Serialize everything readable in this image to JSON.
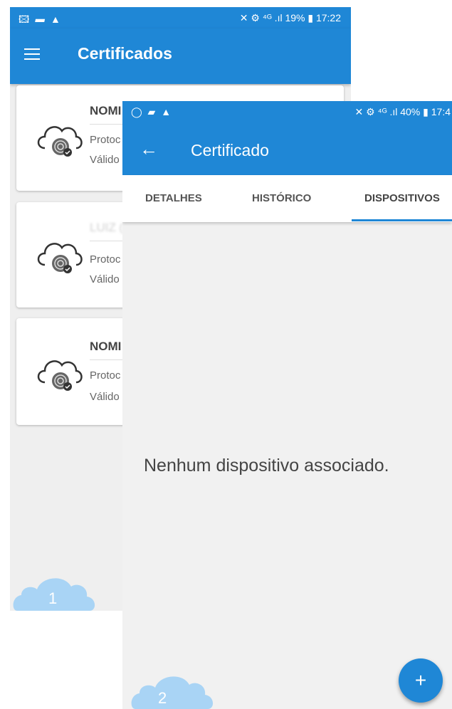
{
  "screen1": {
    "status": {
      "left_icons": "🖾 ▰ ▲",
      "right": "✕ ⚙ ⁴ᴳ .ıl 19% ▮ 17:22"
    },
    "title": "Certificados",
    "cards": [
      {
        "name": "NOMI",
        "protocol": "Protoc",
        "valid": "Válido"
      },
      {
        "name": "LUIZ (",
        "protocol": "Protoc",
        "valid": "Válido"
      },
      {
        "name": "NOMI",
        "protocol": "Protoc",
        "valid": "Válido"
      }
    ],
    "badge": "1"
  },
  "screen2": {
    "status": {
      "left_icons": "◯ ▰ ▲",
      "right": "✕ ⚙ ⁴ᴳ .ıl 40% ▮ 17:4"
    },
    "title": "Certificado",
    "back_icon": "arrow-left",
    "tabs": [
      "DETALHES",
      "HISTÓRICO",
      "DISPOSITIVOS"
    ],
    "active_tab": "DISPOSITIVOS",
    "empty_message": "Nenhum dispositivo associado.",
    "fab_label": "+",
    "badge": "2"
  },
  "colors": {
    "primary": "#1f87d6",
    "badge_cloud": "#a9d4f5"
  }
}
